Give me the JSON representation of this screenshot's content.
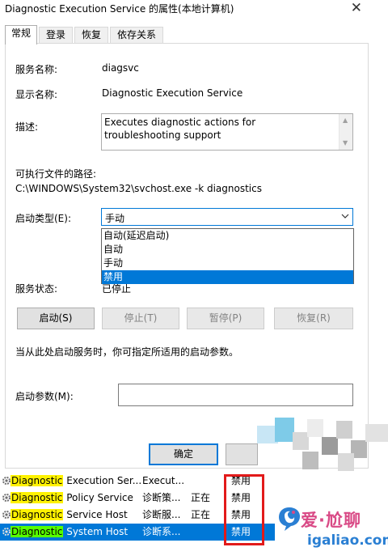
{
  "window": {
    "title": "Diagnostic Execution Service 的属性(本地计算机)",
    "close_glyph": "✕"
  },
  "tabs": [
    {
      "label": "常规",
      "active": true
    },
    {
      "label": "登录",
      "active": false
    },
    {
      "label": "恢复",
      "active": false
    },
    {
      "label": "依存关系",
      "active": false
    }
  ],
  "general": {
    "service_name_label": "服务名称:",
    "service_name_value": "diagsvc",
    "display_name_label": "显示名称:",
    "display_name_value": "Diagnostic Execution Service",
    "description_label": "描述:",
    "description_value": "Executes diagnostic actions for troubleshooting support",
    "exe_path_label": "可执行文件的路径:",
    "exe_path_value": "C:\\WINDOWS\\System32\\svchost.exe -k diagnostics",
    "startup_type_label": "启动类型(E):",
    "startup_type_value": "手动",
    "startup_options": [
      "自动(延迟启动)",
      "自动",
      "手动",
      "禁用"
    ],
    "startup_selected_option": "禁用",
    "service_status_label": "服务状态:",
    "service_status_value": "已停止",
    "hint_text": "当从此处启动服务时，你可指定所适用的启动参数。",
    "start_params_label": "启动参数(M):",
    "start_params_value": ""
  },
  "buttons": {
    "start": "启动(S)",
    "stop": "停止(T)",
    "pause": "暂停(P)",
    "resume": "恢复(R)",
    "ok": "确定"
  },
  "service_list": [
    {
      "prefix": "Diagnostic",
      "rest": " Execution Ser...",
      "description": "Execut...",
      "status": "",
      "startup": "禁用",
      "selected": false
    },
    {
      "prefix": "Diagnostic",
      "rest": " Policy Service",
      "description": "诊断策...",
      "status": "正在",
      "startup": "禁用",
      "selected": false
    },
    {
      "prefix": "Diagnostic",
      "rest": " Service Host",
      "description": "诊断服...",
      "status": "正在",
      "startup": "禁用",
      "selected": false
    },
    {
      "prefix": "Diagnostic",
      "rest": " System Host",
      "description": "诊断系...",
      "status": "",
      "startup": "禁用",
      "selected": true
    }
  ],
  "watermark": {
    "brand": "爱·尬聊",
    "url": "igaliao.com"
  },
  "colors": {
    "accent": "#0078d7",
    "highlight": "#fff200",
    "highlight_selected": "#56ff00",
    "annotation_red": "#e21a1a",
    "watermark_pink": "#d94a86",
    "watermark_blue": "#2a7fd3"
  }
}
